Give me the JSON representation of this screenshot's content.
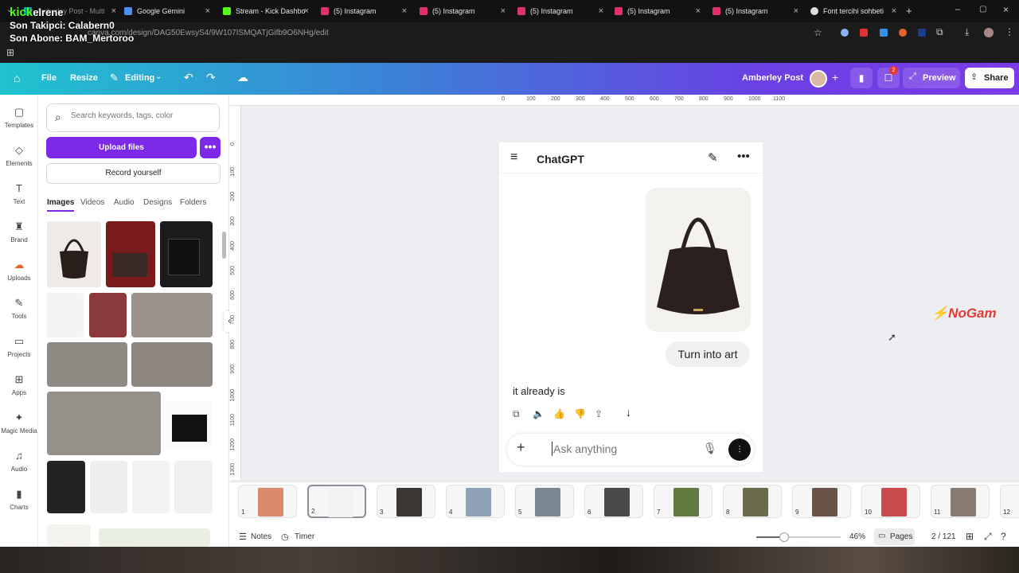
{
  "browser": {
    "tabs": [
      {
        "label": "Amberley Post - Multi",
        "color": "#00c4cc"
      },
      {
        "label": "Google Gemini",
        "color": "#4e8cf5"
      },
      {
        "label": "Stream - Kick Dashbo",
        "color": "#53fc18"
      },
      {
        "label": "(5) Instagram",
        "color": "#e1306c"
      },
      {
        "label": "(5) Instagram",
        "color": "#e1306c"
      },
      {
        "label": "(5) Instagram",
        "color": "#e1306c"
      },
      {
        "label": "(5) Instagram",
        "color": "#e1306c"
      },
      {
        "label": "(5) Instagram",
        "color": "#e1306c"
      },
      {
        "label": "Font tercihi sohbeti",
        "color": "#dddddd"
      }
    ],
    "url": "canva.com/design/DAG50EwsyS4/9W107ISMQATjGifb9O6NHg/edit"
  },
  "stream_overlay": {
    "kick": "kick",
    "line1_suffix": "elrene",
    "line2": "Son Takipci: Calabern0",
    "line3": "Son Abone: BAM_Mertoroo"
  },
  "header": {
    "file": "File",
    "resize": "Resize",
    "editing": "Editing",
    "title": "Amberley Post",
    "preview": "Preview",
    "share": "Share",
    "comments_badge": "2"
  },
  "rail": [
    {
      "label": "Templates",
      "icon": "templates-icon",
      "glyph": "▢"
    },
    {
      "label": "Elements",
      "icon": "elements-icon",
      "glyph": "◇"
    },
    {
      "label": "Text",
      "icon": "text-icon",
      "glyph": "T"
    },
    {
      "label": "Brand",
      "icon": "brand-icon",
      "glyph": "♜"
    },
    {
      "label": "Uploads",
      "icon": "uploads-icon",
      "glyph": "☁"
    },
    {
      "label": "Tools",
      "icon": "tools-icon",
      "glyph": "✎"
    },
    {
      "label": "Projects",
      "icon": "projects-icon",
      "glyph": "▭"
    },
    {
      "label": "Apps",
      "icon": "apps-icon",
      "glyph": "⊞"
    },
    {
      "label": "Magic Media",
      "icon": "magic-media-icon",
      "glyph": "✦"
    },
    {
      "label": "Audio",
      "icon": "audio-icon",
      "glyph": "♫"
    },
    {
      "label": "Charts",
      "icon": "charts-icon",
      "glyph": "▮"
    }
  ],
  "panel": {
    "search_placeholder": "Search keywords, tags, color",
    "upload": "Upload files",
    "more": "•••",
    "record": "Record yourself",
    "tabs": [
      "Images",
      "Videos",
      "Audio",
      "Designs",
      "Folders"
    ]
  },
  "ruler": {
    "top": [
      "0",
      "100",
      "200",
      "300",
      "400",
      "500",
      "600",
      "700",
      "800",
      "900",
      "1000",
      "1100"
    ],
    "left": [
      "0",
      "100",
      "200",
      "300",
      "400",
      "500",
      "600",
      "700",
      "800",
      "900",
      "1000",
      "1100",
      "1200",
      "1300"
    ]
  },
  "chat": {
    "app_title": "ChatGPT",
    "user_message": "Turn into art",
    "reply": "it already is",
    "input_placeholder": "Ask anything"
  },
  "pages": [
    "1",
    "2",
    "3",
    "4",
    "5",
    "6",
    "7",
    "8",
    "9",
    "10",
    "11",
    "12"
  ],
  "bottom": {
    "notes": "Notes",
    "timer": "Timer",
    "zoom": "46%",
    "zoom_level": 0.46,
    "pages_label": "Pages",
    "page_count": "2 / 121"
  },
  "watermark": "NoGam"
}
